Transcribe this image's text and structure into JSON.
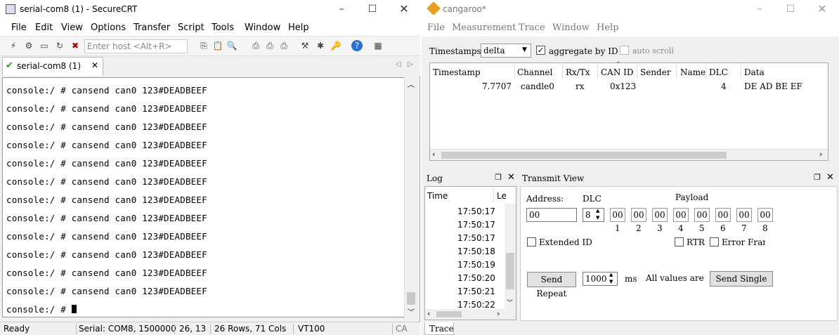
{
  "crt": {
    "title": "serial-com8 (1) - SecureCRT",
    "menu": [
      "File",
      "Edit",
      "View",
      "Options",
      "Transfer",
      "Script",
      "Tools",
      "Window",
      "Help"
    ],
    "host_placeholder": "Enter host <Alt+R>",
    "tab_label": "serial-com8 (1)",
    "lines": [
      "console:/ # cansend can0 123#DEADBEEF",
      "console:/ # cansend can0 123#DEADBEEF",
      "console:/ # cansend can0 123#DEADBEEF",
      "console:/ # cansend can0 123#DEADBEEF",
      "console:/ # cansend can0 123#DEADBEEF",
      "console:/ # cansend can0 123#DEADBEEF",
      "console:/ # cansend can0 123#DEADBEEF",
      "console:/ # cansend can0 123#DEADBEEF",
      "console:/ # cansend can0 123#DEADBEEF",
      "console:/ # cansend can0 123#DEADBEEF",
      "console:/ # cansend can0 123#DEADBEEF",
      "console:/ # cansend can0 123#DEADBEEF"
    ],
    "prompt": "console:/ # ",
    "status": {
      "ready": "Ready",
      "serial": "Serial: COM8, 1500000",
      "pos": "26,  13",
      "size": "26 Rows, 71 Cols",
      "term": "VT100",
      "caps": "CA"
    }
  },
  "cg": {
    "title": "cangaroo*",
    "menu": [
      "File",
      "Measurement",
      "Trace",
      "Window",
      "Help"
    ],
    "timestamps_label": "Timestamps:",
    "timestamps_value": "delta",
    "aggregate_label": "aggregate by ID",
    "aggregate_checked": true,
    "autoscroll_label": "auto scroll",
    "columns": [
      "Timestamp",
      "Channel",
      "Rx/Tx",
      "CAN ID",
      "Sender",
      "Name",
      "DLC",
      "Data"
    ],
    "row": {
      "timestamp": "7.7707",
      "channel": "candle0",
      "rxtx": "rx",
      "canid": "0x123",
      "sender": "",
      "name": "",
      "dlc": "4",
      "data": "DE AD BE EF"
    },
    "log": {
      "title": "Log",
      "col_time": "Time",
      "col_level": "Le",
      "times": [
        "17:50:17",
        "17:50:17",
        "17:50:17",
        "17:50:18",
        "17:50:19",
        "17:50:20",
        "17:50:21",
        "17:50:22"
      ]
    },
    "transmit": {
      "title": "Transmit View",
      "address_label": "Address:",
      "dlc_label": "DLC",
      "payload_label": "Payload",
      "address_value": "00",
      "dlc_value": "8",
      "payload": [
        "00",
        "00",
        "00",
        "00",
        "00",
        "00",
        "00",
        "00"
      ],
      "payload_index": [
        "1",
        "2",
        "3",
        "4",
        "5",
        "6",
        "7",
        "8"
      ],
      "extended_label": "Extended ID",
      "rtr_label": "RTR",
      "error_label": "Error Fram",
      "send_repeat": "Send Repeat",
      "repeat_value": "1000",
      "ms": "ms",
      "all_values": "All values are",
      "send_single": "Send Single"
    },
    "bottom_tab": "Trace"
  }
}
